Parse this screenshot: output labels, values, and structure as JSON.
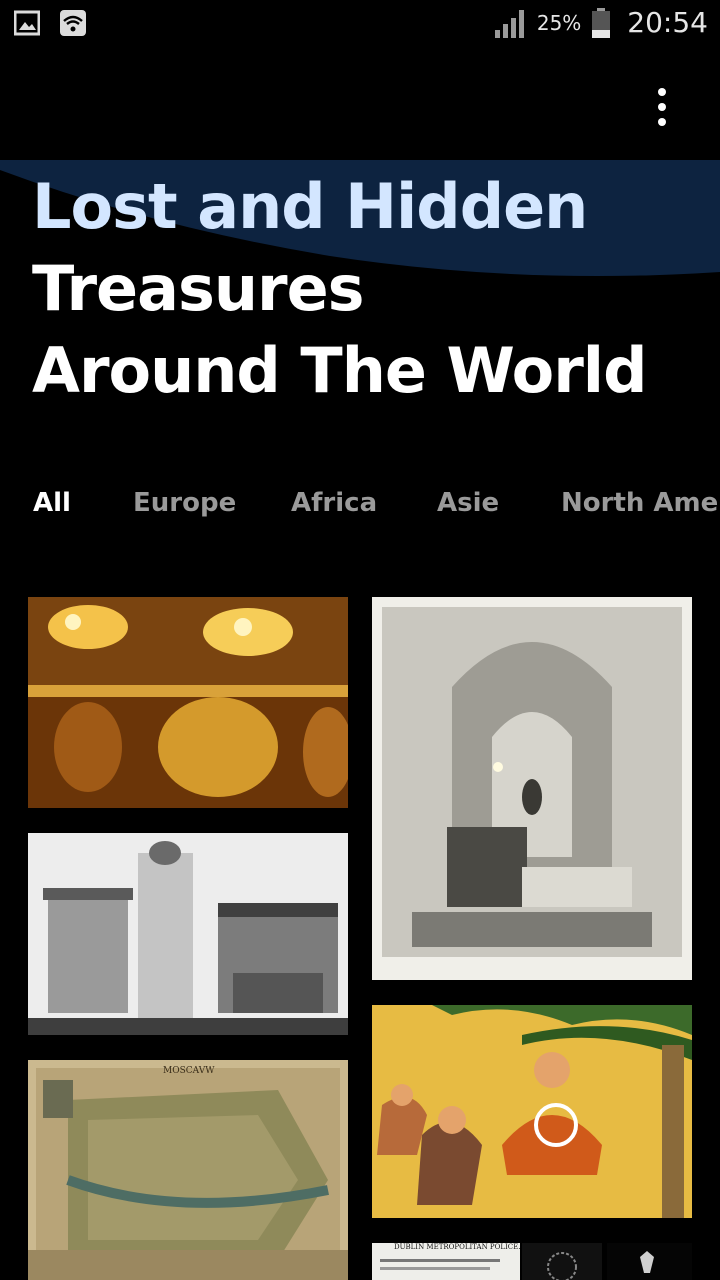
{
  "status_bar": {
    "battery_percent": "25%",
    "time": "20:54",
    "icons": [
      "gallery-icon",
      "wifi-icon",
      "signal-icon",
      "battery-icon"
    ]
  },
  "header": {
    "title_line1": "Lost and Hidden",
    "title_line2": "Treasures",
    "title_line3": "Around The World"
  },
  "tabs": [
    {
      "label": "All",
      "active": true
    },
    {
      "label": "Europe",
      "active": false
    },
    {
      "label": "Africa",
      "active": false
    },
    {
      "label": "Asie",
      "active": false
    },
    {
      "label": "North America",
      "active": false
    }
  ],
  "gallery": {
    "card_newspaper_text": "DUBLIN METROPOLITAN POLICE.",
    "card_map_text": "MOSCAVW"
  },
  "colors": {
    "background": "#000000",
    "title_accent": "#d3e6ff",
    "header_wave": "#0d2340",
    "tab_inactive": "#9a9a9a"
  }
}
